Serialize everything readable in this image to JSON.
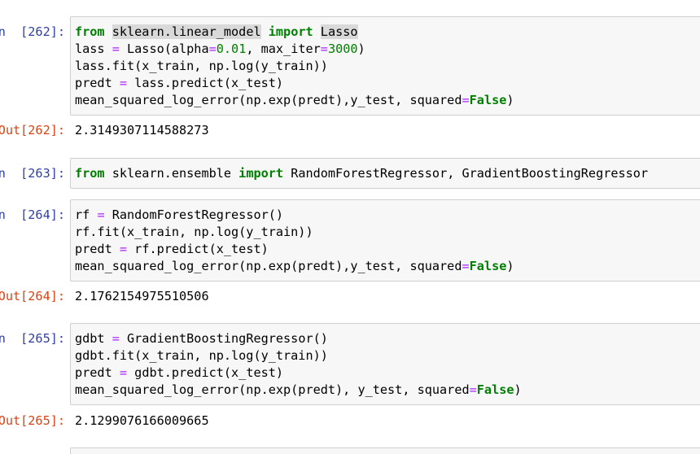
{
  "cells": [
    {
      "in_prompt": "n  [262]:",
      "code": [
        [
          {
            "t": "from",
            "c": "kw"
          },
          {
            "t": " "
          },
          {
            "t": "sklearn.linear_model",
            "c": "hl"
          },
          {
            "t": " "
          },
          {
            "t": "import",
            "c": "kw"
          },
          {
            "t": " "
          },
          {
            "t": "Lasso",
            "c": "hl"
          }
        ],
        [
          {
            "t": "lass "
          },
          {
            "t": "=",
            "c": "op"
          },
          {
            "t": " Lasso(alpha"
          },
          {
            "t": "=",
            "c": "op"
          },
          {
            "t": "0.01",
            "c": "num"
          },
          {
            "t": ", max_iter"
          },
          {
            "t": "=",
            "c": "op"
          },
          {
            "t": "3000",
            "c": "num"
          },
          {
            "t": ")"
          }
        ],
        [
          {
            "t": "lass.fit(x_train, np.log(y_train))"
          }
        ],
        [
          {
            "t": "predt "
          },
          {
            "t": "=",
            "c": "op"
          },
          {
            "t": " lass.predict(x_test)"
          }
        ],
        [
          {
            "t": "mean_squared_log_error(np.exp(predt),y_test, squared"
          },
          {
            "t": "=",
            "c": "op"
          },
          {
            "t": "False",
            "c": "kw"
          },
          {
            "t": ")"
          }
        ]
      ],
      "out_prompt": "Out[262]:",
      "output": "2.3149307114588273"
    },
    {
      "in_prompt": "n  [263]:",
      "code": [
        [
          {
            "t": "from",
            "c": "kw"
          },
          {
            "t": " sklearn.ensemble "
          },
          {
            "t": "import",
            "c": "kw"
          },
          {
            "t": " RandomForestRegressor, GradientBoostingRegressor"
          }
        ]
      ]
    },
    {
      "in_prompt": "n  [264]:",
      "code": [
        [
          {
            "t": "rf "
          },
          {
            "t": "=",
            "c": "op"
          },
          {
            "t": " RandomForestRegressor()"
          }
        ],
        [
          {
            "t": "rf.fit(x_train, np.log(y_train))"
          }
        ],
        [
          {
            "t": "predt "
          },
          {
            "t": "=",
            "c": "op"
          },
          {
            "t": " rf.predict(x_test)"
          }
        ],
        [
          {
            "t": "mean_squared_log_error(np.exp(predt),y_test, squared"
          },
          {
            "t": "=",
            "c": "op"
          },
          {
            "t": "False",
            "c": "kw"
          },
          {
            "t": ")"
          }
        ]
      ],
      "out_prompt": "Out[264]:",
      "output": "2.1762154975510506"
    },
    {
      "in_prompt": "n  [265]:",
      "code": [
        [
          {
            "t": "gdbt "
          },
          {
            "t": "=",
            "c": "op"
          },
          {
            "t": " GradientBoostingRegressor()"
          }
        ],
        [
          {
            "t": "gdbt.fit(x_train, np.log(y_train))"
          }
        ],
        [
          {
            "t": "predt "
          },
          {
            "t": "=",
            "c": "op"
          },
          {
            "t": " gdbt.predict(x_test)"
          }
        ],
        [
          {
            "t": "mean_squared_log_error(np.exp(predt), y_test, squared"
          },
          {
            "t": "=",
            "c": "op"
          },
          {
            "t": "False",
            "c": "kw"
          },
          {
            "t": ")"
          }
        ]
      ],
      "out_prompt": "Out[265]:",
      "output": "2.1299076166009665"
    },
    {
      "in_prompt": "",
      "code": []
    }
  ]
}
